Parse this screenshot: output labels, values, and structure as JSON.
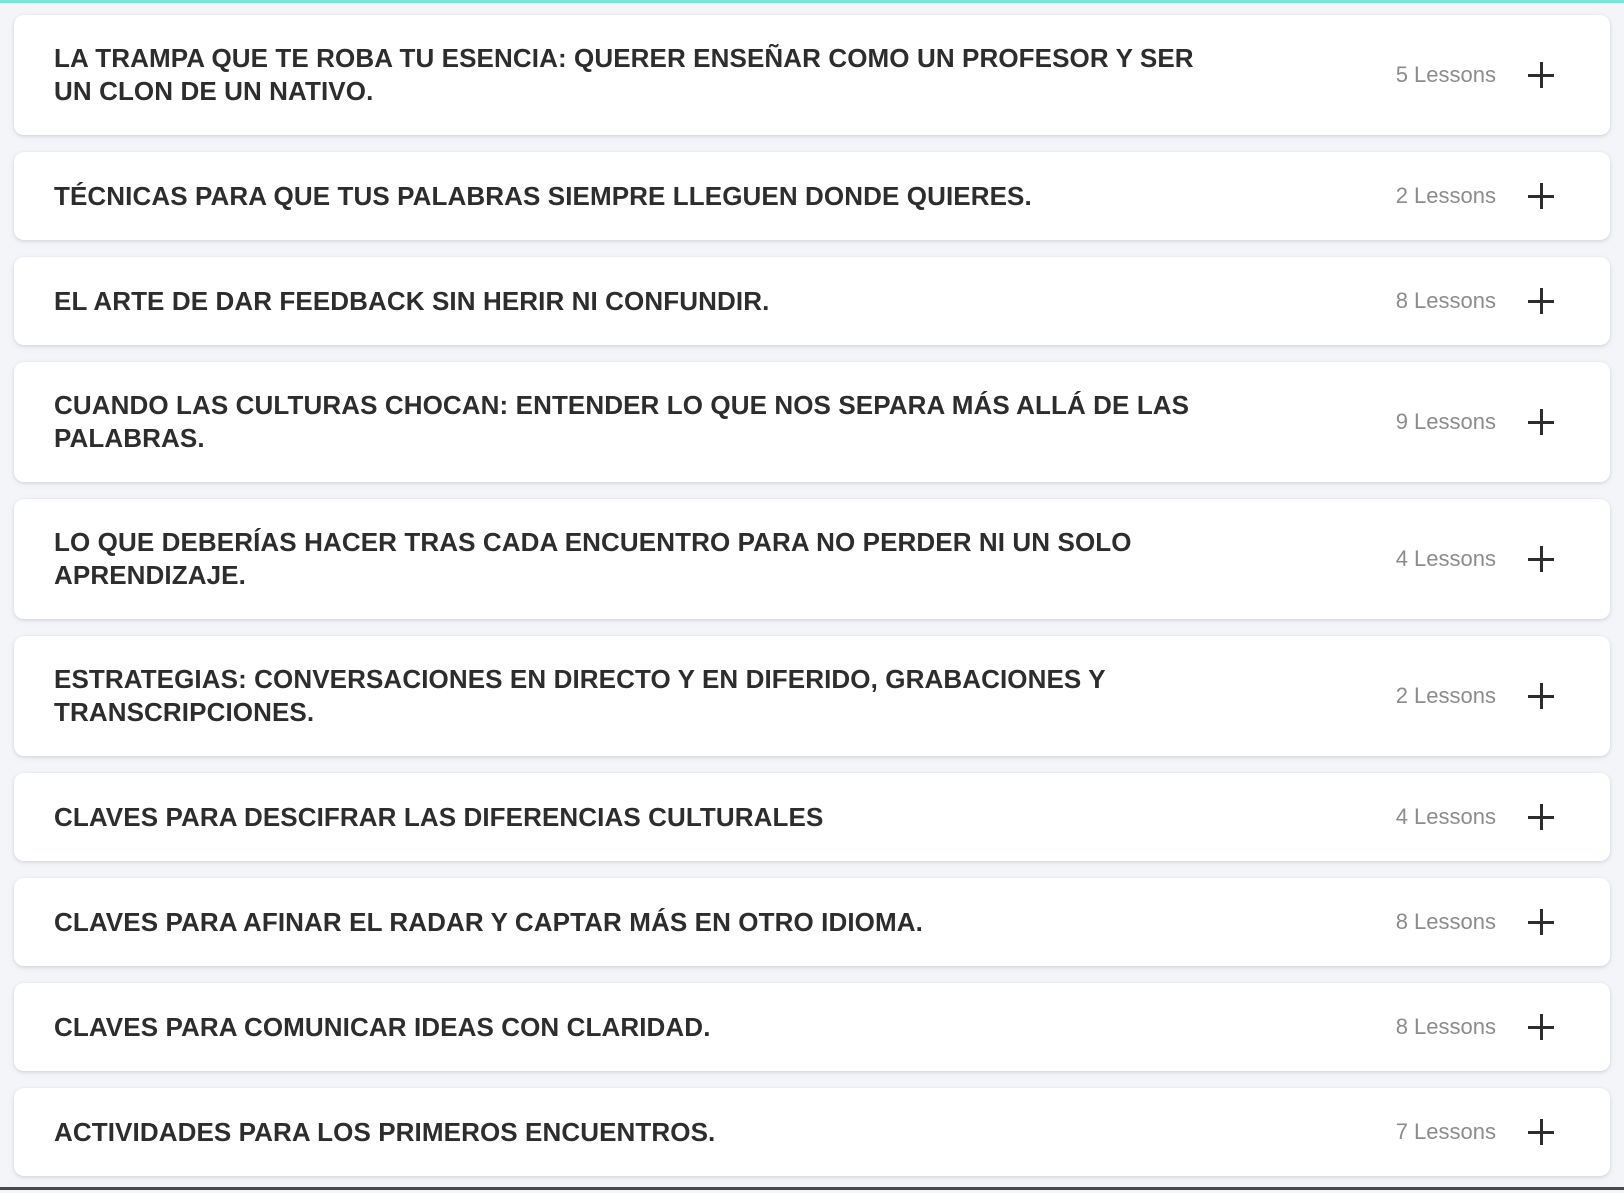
{
  "modules": [
    {
      "title": "LA TRAMPA QUE TE ROBA TU ESENCIA: QUERER ENSEÑAR COMO UN PROFESOR Y SER UN CLON DE UN NATIVO.",
      "lessons": "5 Lessons"
    },
    {
      "title": "TÉCNICAS PARA QUE TUS PALABRAS SIEMPRE LLEGUEN DONDE QUIERES.",
      "lessons": "2 Lessons"
    },
    {
      "title": "EL ARTE DE DAR FEEDBACK SIN HERIR NI CONFUNDIR.",
      "lessons": "8 Lessons"
    },
    {
      "title": "CUANDO LAS CULTURAS CHOCAN: ENTENDER LO QUE NOS SEPARA MÁS ALLÁ DE LAS PALABRAS.",
      "lessons": "9 Lessons"
    },
    {
      "title": "LO QUE DEBERÍAS HACER TRAS CADA ENCUENTRO PARA NO PERDER NI UN SOLO APRENDIZAJE.",
      "lessons": "4 Lessons"
    },
    {
      "title": "ESTRATEGIAS: CONVERSACIONES EN DIRECTO Y EN DIFERIDO, GRABACIONES Y TRANSCRIPCIONES.",
      "lessons": "2 Lessons"
    },
    {
      "title": "CLAVES PARA DESCIFRAR LAS DIFERENCIAS CULTURALES",
      "lessons": "4 Lessons"
    },
    {
      "title": "CLAVES PARA AFINAR EL RADAR Y CAPTAR MÁS EN OTRO IDIOMA.",
      "lessons": "8 Lessons"
    },
    {
      "title": "CLAVES PARA COMUNICAR IDEAS CON CLARIDAD.",
      "lessons": "8 Lessons"
    },
    {
      "title": "ACTIVIDADES PARA LOS PRIMEROS ENCUENTROS.",
      "lessons": "7 Lessons"
    }
  ]
}
